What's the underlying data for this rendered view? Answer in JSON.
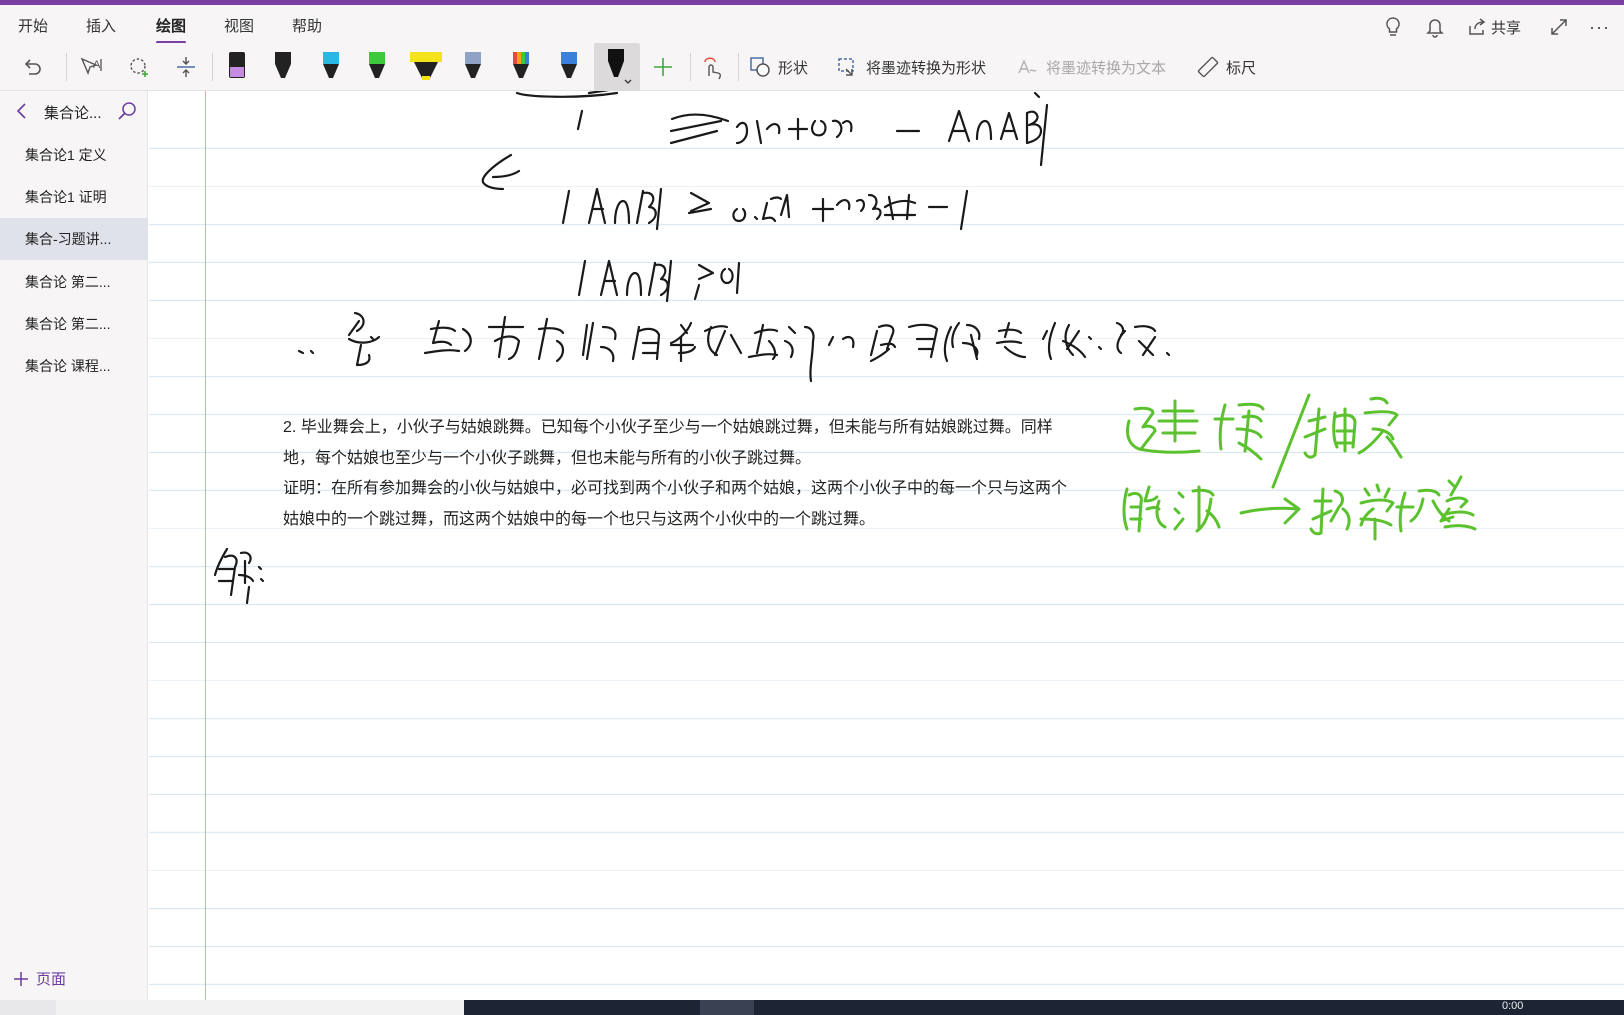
{
  "menu": {
    "items": [
      "开始",
      "插入",
      "绘图",
      "视图",
      "帮助"
    ],
    "active": "绘图",
    "share_label": "共享"
  },
  "toolbar": {
    "shapes_label": "形状",
    "ink_to_shape_label": "将墨迹转换为形状",
    "ink_to_text_label": "将墨迹转换为文本",
    "ruler_label": "标尺",
    "pens": [
      {
        "name": "pen-purple",
        "color": "#c58be0"
      },
      {
        "name": "pen-black",
        "color": "#222222"
      },
      {
        "name": "pen-cyan",
        "color": "#29b7e6"
      },
      {
        "name": "pen-green",
        "color": "#3ec83a"
      },
      {
        "name": "highlighter-yellow",
        "color": "#f4e21a"
      },
      {
        "name": "pen-galaxy",
        "color": "#8fa3c7"
      },
      {
        "name": "pen-rainbow",
        "color": "#e24b3a"
      },
      {
        "name": "pen-ocean",
        "color": "#3a7fd8"
      },
      {
        "name": "pen-black-selected",
        "color": "#111111"
      }
    ],
    "add_pen_icon": "plus-icon"
  },
  "sidebar": {
    "section_title": "集合论...",
    "pages": [
      "集合论1 定义",
      "集合论1 证明",
      "集合-习题讲...",
      "集合论 第二...",
      "集合论 第二...",
      "集合论 课程..."
    ],
    "active_index": 2,
    "add_page_label": "页面"
  },
  "page": {
    "problem_lines": [
      "2. 毕业舞会上，小伙子与姑娘跳舞。已知每个小伙子至少与一个姑娘跳过舞，但未能与所有姑娘跳过舞。同样",
      "地，每个姑娘也至少与一个小伙子跳舞，但也未能与所有的小伙子跳过舞。",
      "证明：在所有参加舞会的小伙与姑娘中，必可找到两个小伙子和两个姑娘，这两个小伙子中的每一个只与这两个",
      "姑娘中的一个跳过舞，而这两个姑娘中的每一个也只与这两个小伙中的一个跳过舞。"
    ],
    "ink_color_black": "#1a1a1a",
    "ink_color_green": "#5cc12e"
  },
  "taskbar": {
    "time": "0:00"
  }
}
